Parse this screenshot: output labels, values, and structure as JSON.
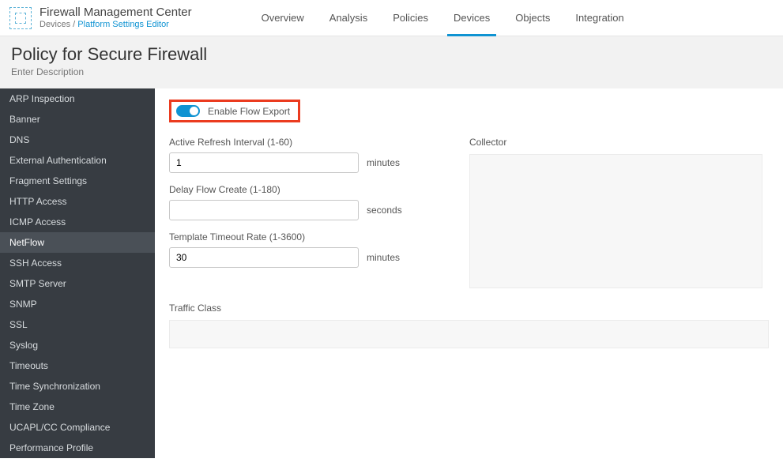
{
  "header": {
    "appTitle": "Firewall Management Center",
    "breadcrumbParent": "Devices",
    "breadcrumbSep": " / ",
    "breadcrumbCurrent": "Platform Settings Editor",
    "nav": [
      {
        "label": "Overview",
        "active": false
      },
      {
        "label": "Analysis",
        "active": false
      },
      {
        "label": "Policies",
        "active": false
      },
      {
        "label": "Devices",
        "active": true
      },
      {
        "label": "Objects",
        "active": false
      },
      {
        "label": "Integration",
        "active": false
      }
    ]
  },
  "subheader": {
    "title": "Policy for Secure Firewall",
    "desc": "Enter Description"
  },
  "sidebar": {
    "items": [
      {
        "label": "ARP Inspection",
        "selected": false
      },
      {
        "label": "Banner",
        "selected": false
      },
      {
        "label": "DNS",
        "selected": false
      },
      {
        "label": "External Authentication",
        "selected": false
      },
      {
        "label": "Fragment Settings",
        "selected": false
      },
      {
        "label": "HTTP Access",
        "selected": false
      },
      {
        "label": "ICMP Access",
        "selected": false
      },
      {
        "label": "NetFlow",
        "selected": true
      },
      {
        "label": "SSH Access",
        "selected": false
      },
      {
        "label": "SMTP Server",
        "selected": false
      },
      {
        "label": "SNMP",
        "selected": false
      },
      {
        "label": "SSL",
        "selected": false
      },
      {
        "label": "Syslog",
        "selected": false
      },
      {
        "label": "Timeouts",
        "selected": false
      },
      {
        "label": "Time Synchronization",
        "selected": false
      },
      {
        "label": "Time Zone",
        "selected": false
      },
      {
        "label": "UCAPL/CC Compliance",
        "selected": false
      },
      {
        "label": "Performance Profile",
        "selected": false
      }
    ]
  },
  "content": {
    "toggleLabel": "Enable Flow Export",
    "activeRefresh": {
      "label": "Active Refresh Interval (1-60)",
      "value": "1",
      "unit": "minutes"
    },
    "delayFlow": {
      "label": "Delay Flow Create (1-180)",
      "value": "",
      "unit": "seconds"
    },
    "templateTimeout": {
      "label": "Template Timeout Rate (1-3600)",
      "value": "30",
      "unit": "minutes"
    },
    "collectorLabel": "Collector",
    "trafficClassLabel": "Traffic Class"
  }
}
